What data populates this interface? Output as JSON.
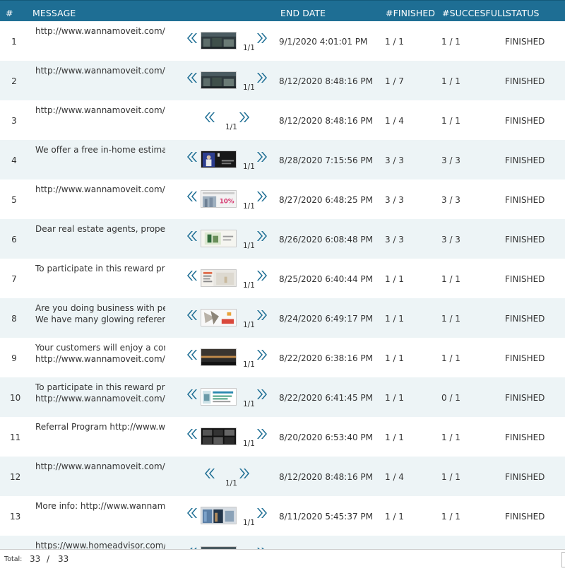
{
  "columns": {
    "num": "#",
    "message": "MESSAGE",
    "end_date": "END DATE",
    "finished": "#FINISHED",
    "successful": "#SUCCESFULL",
    "status": "STATUS"
  },
  "rows": [
    {
      "num": "1",
      "msg": [
        "http://www.wannamoveit.com/re"
      ],
      "thumb": "thumb-dark-street",
      "pager": "1/1",
      "end_date": "9/1/2020 4:01:01 PM",
      "finished": "1 / 1",
      "successful": "1 / 1",
      "status": "FINISHED"
    },
    {
      "num": "2",
      "msg": [
        "http://www.wannamoveit.com/re"
      ],
      "thumb": "thumb-dark-street",
      "pager": "1/1",
      "end_date": "8/12/2020 8:48:16 PM",
      "finished": "1 / 7",
      "successful": "1 / 1",
      "status": "FINISHED"
    },
    {
      "num": "3",
      "msg": [
        "http://www.wannamoveit.com/re"
      ],
      "thumb": "",
      "pager": "1/1",
      "end_date": "8/12/2020 8:48:16 PM",
      "finished": "1 / 4",
      "successful": "1 / 1",
      "status": "FINISHED"
    },
    {
      "num": "4",
      "msg": [
        "We offer a free in-home estimate"
      ],
      "thumb": "thumb-movers-dark",
      "pager": "1/1",
      "end_date": "8/28/2020 7:15:56 PM",
      "finished": "3 / 3",
      "successful": "3 / 3",
      "status": "FINISHED"
    },
    {
      "num": "5",
      "msg": [
        "http://www.wannamoveit.com/re"
      ],
      "thumb": "thumb-discount",
      "pager": "1/1",
      "end_date": "8/27/2020 6:48:25 PM",
      "finished": "3 / 3",
      "successful": "3 / 3",
      "status": "FINISHED"
    },
    {
      "num": "6",
      "msg": [
        "Dear real estate agents, property"
      ],
      "thumb": "thumb-green-card",
      "pager": "1/1",
      "end_date": "8/26/2020 6:08:48 PM",
      "finished": "3 / 3",
      "successful": "3 / 3",
      "status": "FINISHED"
    },
    {
      "num": "7",
      "msg": [
        "To participate in this reward prog"
      ],
      "thumb": "thumb-room",
      "pager": "1/1",
      "end_date": "8/25/2020 6:40:44 PM",
      "finished": "1 / 1",
      "successful": "1 / 1",
      "status": "FINISHED"
    },
    {
      "num": "8",
      "msg": [
        "Are you doing business with peop",
        "We have many glowing reference"
      ],
      "thumb": "thumb-collage",
      "pager": "1/1",
      "end_date": "8/24/2020 6:49:17 PM",
      "finished": "1 / 1",
      "successful": "1 / 1",
      "status": "FINISHED"
    },
    {
      "num": "9",
      "msg": [
        "Your customers will enjoy a comf",
        "http://www.wannamoveit.com/re"
      ],
      "thumb": "thumb-sunset",
      "pager": "1/1",
      "end_date": "8/22/2020 6:38:16 PM",
      "finished": "1 / 1",
      "successful": "1 / 1",
      "status": "FINISHED"
    },
    {
      "num": "10",
      "msg": [
        "To participate in this reward prog",
        "http://www.wannamoveit.com/re"
      ],
      "thumb": "thumb-flyer",
      "pager": "1/1",
      "end_date": "8/22/2020 6:41:45 PM",
      "finished": "1 / 1",
      "successful": "0 / 1",
      "status": "FINISHED"
    },
    {
      "num": "11",
      "msg": [
        "Referral Program http://www.wa"
      ],
      "thumb": "thumb-dark-grid",
      "pager": "1/1",
      "end_date": "8/20/2020 6:53:40 PM",
      "finished": "1 / 1",
      "successful": "1 / 1",
      "status": "FINISHED"
    },
    {
      "num": "12",
      "msg": [
        "http://www.wannamoveit.com/re"
      ],
      "thumb": "",
      "pager": "1/1",
      "end_date": "8/12/2020 8:48:16 PM",
      "finished": "1 / 4",
      "successful": "1 / 1",
      "status": "FINISHED"
    },
    {
      "num": "13",
      "msg": [
        "More info: http://www.wannamo"
      ],
      "thumb": "thumb-blue-doors",
      "pager": "1/1",
      "end_date": "8/11/2020 5:45:37 PM",
      "finished": "1 / 1",
      "successful": "1 / 1",
      "status": "FINISHED"
    },
    {
      "num": "",
      "msg": [
        "https://www.homeadvisor.com/r"
      ],
      "thumb": "thumb-dark-street",
      "pager": "",
      "end_date": "",
      "finished": "",
      "successful": "",
      "status": ""
    }
  ],
  "footer": {
    "total_label": "Total:",
    "shown": "33",
    "separator": "/",
    "total": "33"
  },
  "colors": {
    "header_bg": "#1e6e94",
    "accent_chevron": "#1e6e94",
    "alt_row": "#edf4f6"
  }
}
